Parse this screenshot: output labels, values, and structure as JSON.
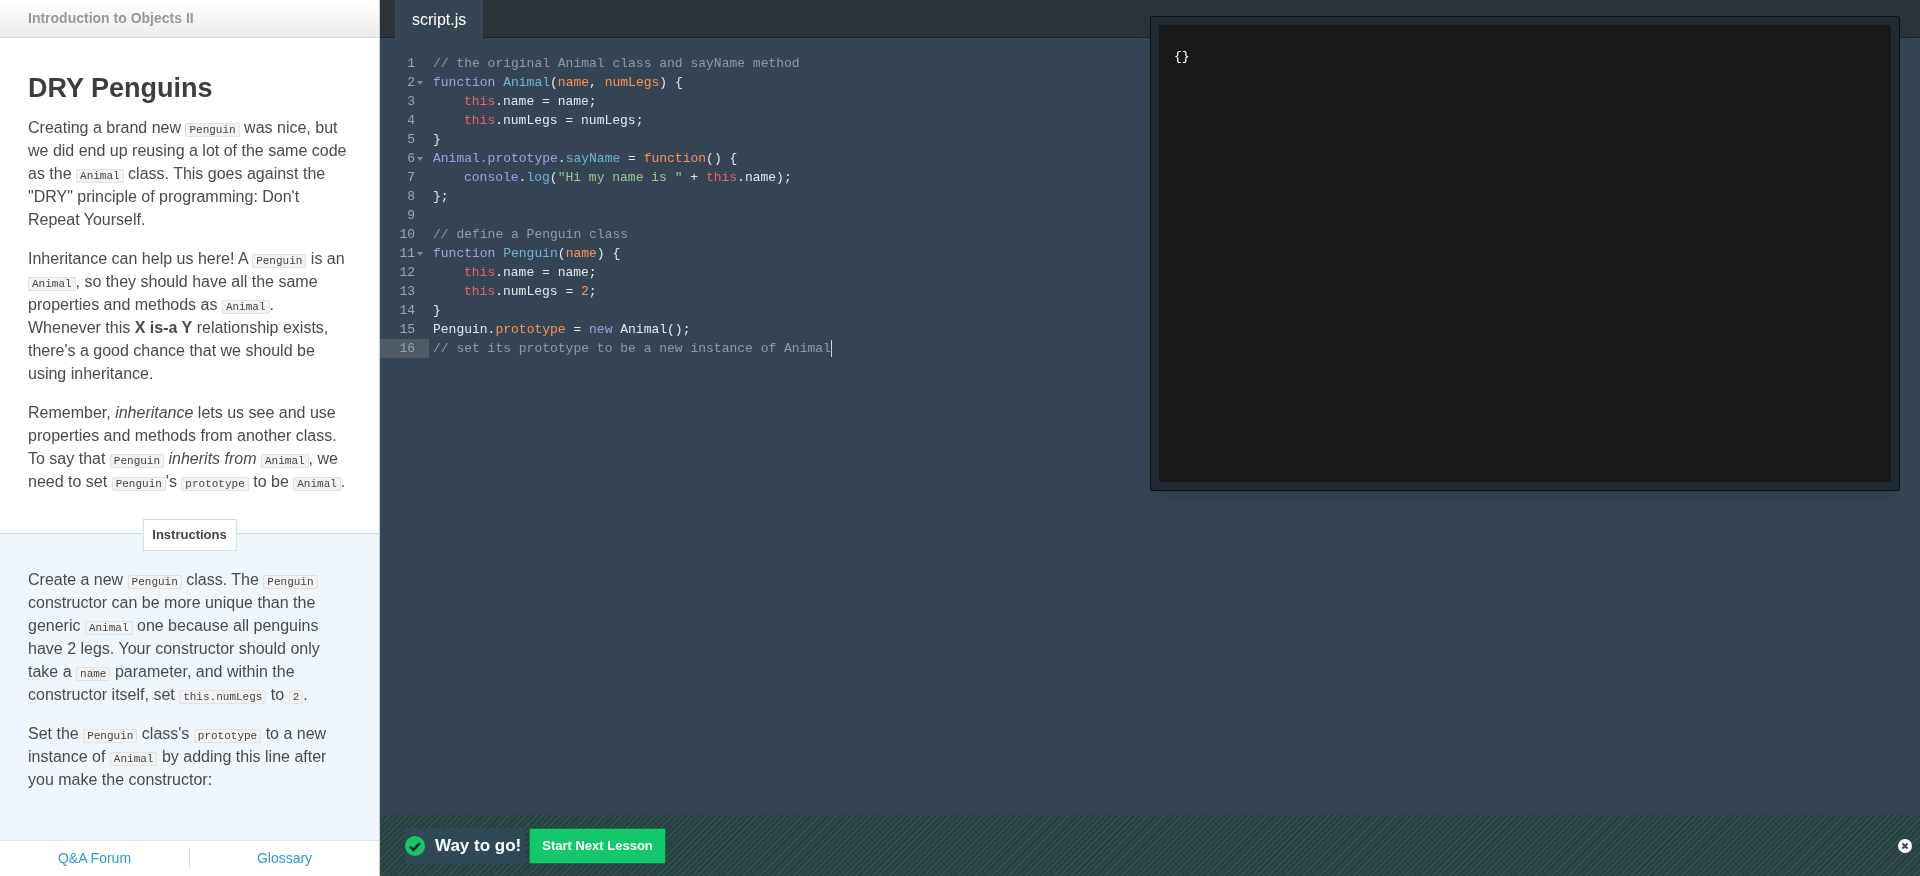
{
  "course_title": "Introduction to Objects II",
  "lesson": {
    "title": "DRY Penguins",
    "paragraphs": [
      [
        {
          "kind": "text",
          "text": "Creating a brand new "
        },
        {
          "kind": "code",
          "text": "Penguin"
        },
        {
          "kind": "text",
          "text": " was nice, but we did end up reusing a lot of the same code as the "
        },
        {
          "kind": "code",
          "text": "Animal"
        },
        {
          "kind": "text",
          "text": " class. This goes against the \"DRY\" principle of programming: Don't Repeat Yourself."
        }
      ],
      [
        {
          "kind": "text",
          "text": "Inheritance can help us here! A "
        },
        {
          "kind": "code",
          "text": "Penguin"
        },
        {
          "kind": "text",
          "text": " is an "
        },
        {
          "kind": "code",
          "text": "Animal"
        },
        {
          "kind": "text",
          "text": ", so they should have all the same properties and methods as "
        },
        {
          "kind": "code",
          "text": "Animal"
        },
        {
          "kind": "text",
          "text": ". Whenever this **X is-a Y** relationship exists, there's a good chance that we should be using inheritance."
        }
      ],
      [
        {
          "kind": "text",
          "text": "Remember, *inheritance* lets us see and use properties and methods from another class. To say that "
        },
        {
          "kind": "code",
          "text": "Penguin"
        },
        {
          "kind": "text",
          "text": " *inherits from* "
        },
        {
          "kind": "code",
          "text": "Animal"
        },
        {
          "kind": "text",
          "text": ", we need to set "
        },
        {
          "kind": "code",
          "text": "Penguin"
        },
        {
          "kind": "text",
          "text": "'s "
        },
        {
          "kind": "code",
          "text": "prototype"
        },
        {
          "kind": "text",
          "text": " to be "
        },
        {
          "kind": "code",
          "text": "Animal"
        },
        {
          "kind": "text",
          "text": "."
        }
      ]
    ]
  },
  "instructions": {
    "label": "Instructions",
    "paragraphs": [
      [
        {
          "kind": "text",
          "text": "Create a new "
        },
        {
          "kind": "code",
          "text": "Penguin"
        },
        {
          "kind": "text",
          "text": " class. The "
        },
        {
          "kind": "code",
          "text": "Penguin"
        },
        {
          "kind": "text",
          "text": " constructor can be more unique than the generic "
        },
        {
          "kind": "code",
          "text": "Animal"
        },
        {
          "kind": "text",
          "text": " one because all penguins have 2 legs. Your constructor should only take a "
        },
        {
          "kind": "code",
          "text": "name"
        },
        {
          "kind": "text",
          "text": " parameter, and within the constructor itself, set "
        },
        {
          "kind": "code",
          "text": "this.numLegs"
        },
        {
          "kind": "text",
          "text": " to "
        },
        {
          "kind": "code",
          "text": "2"
        },
        {
          "kind": "text",
          "text": "."
        }
      ],
      [
        {
          "kind": "text",
          "text": "Set the "
        },
        {
          "kind": "code",
          "text": "Penguin"
        },
        {
          "kind": "text",
          "text": " class's "
        },
        {
          "kind": "code",
          "text": "prototype"
        },
        {
          "kind": "text",
          "text": " to a new instance of "
        },
        {
          "kind": "code",
          "text": "Animal"
        },
        {
          "kind": "text",
          "text": " by adding this line after you make the constructor:"
        }
      ]
    ]
  },
  "footer_links": [
    "Q&A Forum",
    "Glossary"
  ],
  "editor": {
    "tabs": [
      {
        "label": "script.js",
        "selected": true
      }
    ],
    "lines": [
      {
        "number": "1",
        "fold": false,
        "active": false,
        "tokens": [
          {
            "kind": "comment",
            "text": "// the original Animal class and sayName method"
          }
        ]
      },
      {
        "number": "2",
        "fold": true,
        "active": false,
        "tokens": [
          {
            "kind": "keyword",
            "text": "function "
          },
          {
            "kind": "fn",
            "text": "Animal"
          },
          {
            "kind": "plain",
            "text": "("
          },
          {
            "kind": "param",
            "text": "name"
          },
          {
            "kind": "plain",
            "text": ", "
          },
          {
            "kind": "param",
            "text": "numLegs"
          },
          {
            "kind": "plain",
            "text": ") {"
          }
        ]
      },
      {
        "number": "3",
        "fold": false,
        "active": false,
        "tokens": [
          {
            "kind": "indent"
          },
          {
            "kind": "this",
            "text": "this"
          },
          {
            "kind": "plain",
            "text": ".name = name;"
          }
        ]
      },
      {
        "number": "4",
        "fold": false,
        "active": false,
        "tokens": [
          {
            "kind": "indent"
          },
          {
            "kind": "this",
            "text": "this"
          },
          {
            "kind": "plain",
            "text": ".numLegs = numLegs;"
          }
        ]
      },
      {
        "number": "5",
        "fold": false,
        "active": false,
        "tokens": [
          {
            "kind": "plain",
            "text": "}"
          }
        ]
      },
      {
        "number": "6",
        "fold": true,
        "active": false,
        "tokens": [
          {
            "kind": "keyword",
            "text": "Animal.prototype"
          },
          {
            "kind": "plain",
            "text": "."
          },
          {
            "kind": "fn",
            "text": "sayName"
          },
          {
            "kind": "plain",
            "text": " = "
          },
          {
            "kind": "param",
            "text": "function"
          },
          {
            "kind": "plain",
            "text": "() {"
          }
        ]
      },
      {
        "number": "7",
        "fold": false,
        "active": false,
        "tokens": [
          {
            "kind": "indent"
          },
          {
            "kind": "keyword",
            "text": "console"
          },
          {
            "kind": "plain",
            "text": "."
          },
          {
            "kind": "fn",
            "text": "log"
          },
          {
            "kind": "plain",
            "text": "("
          },
          {
            "kind": "string",
            "text": "\"Hi my name is \""
          },
          {
            "kind": "plain",
            "text": " + "
          },
          {
            "kind": "this",
            "text": "this"
          },
          {
            "kind": "plain",
            "text": ".name);"
          }
        ]
      },
      {
        "number": "8",
        "fold": false,
        "active": false,
        "tokens": [
          {
            "kind": "plain",
            "text": "};"
          }
        ]
      },
      {
        "number": "9",
        "fold": false,
        "active": false
      },
      {
        "number": "10",
        "fold": false,
        "active": false,
        "tokens": [
          {
            "kind": "comment",
            "text": "// define a Penguin class"
          }
        ]
      },
      {
        "number": "11",
        "fold": true,
        "active": false,
        "tokens": [
          {
            "kind": "keyword",
            "text": "function "
          },
          {
            "kind": "fn",
            "text": "Penguin"
          },
          {
            "kind": "plain",
            "text": "("
          },
          {
            "kind": "param",
            "text": "name"
          },
          {
            "kind": "plain",
            "text": ") {"
          }
        ]
      },
      {
        "number": "12",
        "fold": false,
        "active": false,
        "tokens": [
          {
            "kind": "indent"
          },
          {
            "kind": "this",
            "text": "this"
          },
          {
            "kind": "plain",
            "text": ".name = name;"
          }
        ]
      },
      {
        "number": "13",
        "fold": false,
        "active": false,
        "tokens": [
          {
            "kind": "indent"
          },
          {
            "kind": "this",
            "text": "this"
          },
          {
            "kind": "plain",
            "text": ".numLegs = "
          },
          {
            "kind": "param",
            "text": "2"
          },
          {
            "kind": "plain",
            "text": ";"
          }
        ]
      },
      {
        "number": "14",
        "fold": false,
        "active": false,
        "tokens": [
          {
            "kind": "plain",
            "text": "}"
          }
        ]
      },
      {
        "number": "15",
        "fold": false,
        "active": false,
        "tokens": [
          {
            "kind": "plain",
            "text": "Penguin."
          },
          {
            "kind": "param",
            "text": "prototype"
          },
          {
            "kind": "plain",
            "text": " = "
          },
          {
            "kind": "keyword",
            "text": "new"
          },
          {
            "kind": "plain",
            "text": " Animal();"
          }
        ]
      },
      {
        "number": "16",
        "fold": false,
        "active": true,
        "tokens": [
          {
            "kind": "comment",
            "text": "// set its prototype to be a new instance of Animal"
          }
        ]
      }
    ]
  },
  "output": {
    "text": "{}"
  },
  "result": {
    "message": "Way to go!",
    "success": true,
    "button": "Start Next Lesson"
  }
}
